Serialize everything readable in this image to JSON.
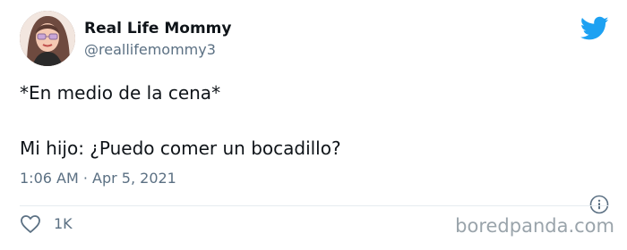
{
  "tweet": {
    "author": {
      "display_name": "Real Life Mommy",
      "handle": "@reallifemommy3"
    },
    "text_lines": [
      "*En medio de la cena*",
      "Mi hijo: ¿Puedo comer un bocadillo?"
    ],
    "timestamp": "1:06 AM · Apr 5, 2021",
    "likes": "1K"
  },
  "icons": {
    "brand": "twitter-bird-icon",
    "info": "info-icon",
    "like": "heart-icon",
    "avatar": "avatar"
  },
  "colors": {
    "twitter_blue": "#1da1f2",
    "text_primary": "#0f1419",
    "text_secondary": "#5b7083",
    "watermark": "#9aa4ab"
  },
  "watermark": {
    "text": "boredpanda.com"
  }
}
